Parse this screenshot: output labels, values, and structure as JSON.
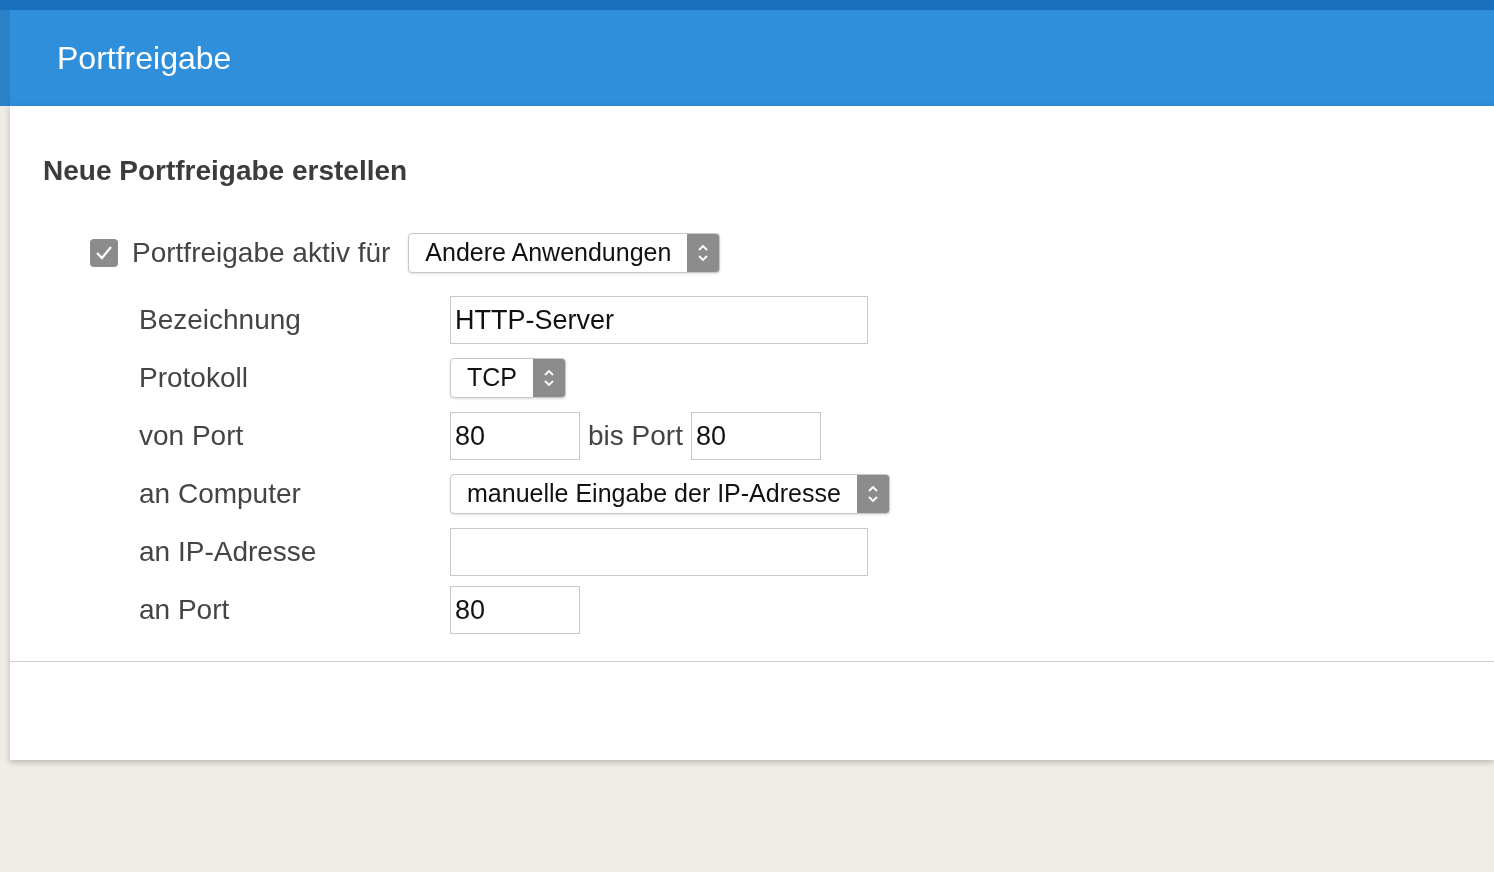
{
  "header": {
    "title": "Portfreigabe"
  },
  "section": {
    "title": "Neue Portfreigabe erstellen"
  },
  "active": {
    "label": "Portfreigabe aktiv für",
    "checked": true,
    "select": "Andere Anwendungen"
  },
  "fields": [
    {
      "kind": "text",
      "label": "Bezeichnung",
      "value": "HTTP-Server"
    },
    {
      "kind": "select",
      "label": "Protokoll",
      "value": "TCP"
    },
    {
      "kind": "range",
      "label": "von Port",
      "value": "80",
      "between": "bis Port",
      "value2": "80"
    },
    {
      "kind": "select",
      "label": "an Computer",
      "value": "manuelle Eingabe der IP-Adresse"
    },
    {
      "kind": "text",
      "label": "an IP-Adresse"
    },
    {
      "kind": "short",
      "label": "an Port",
      "value": "80"
    }
  ]
}
